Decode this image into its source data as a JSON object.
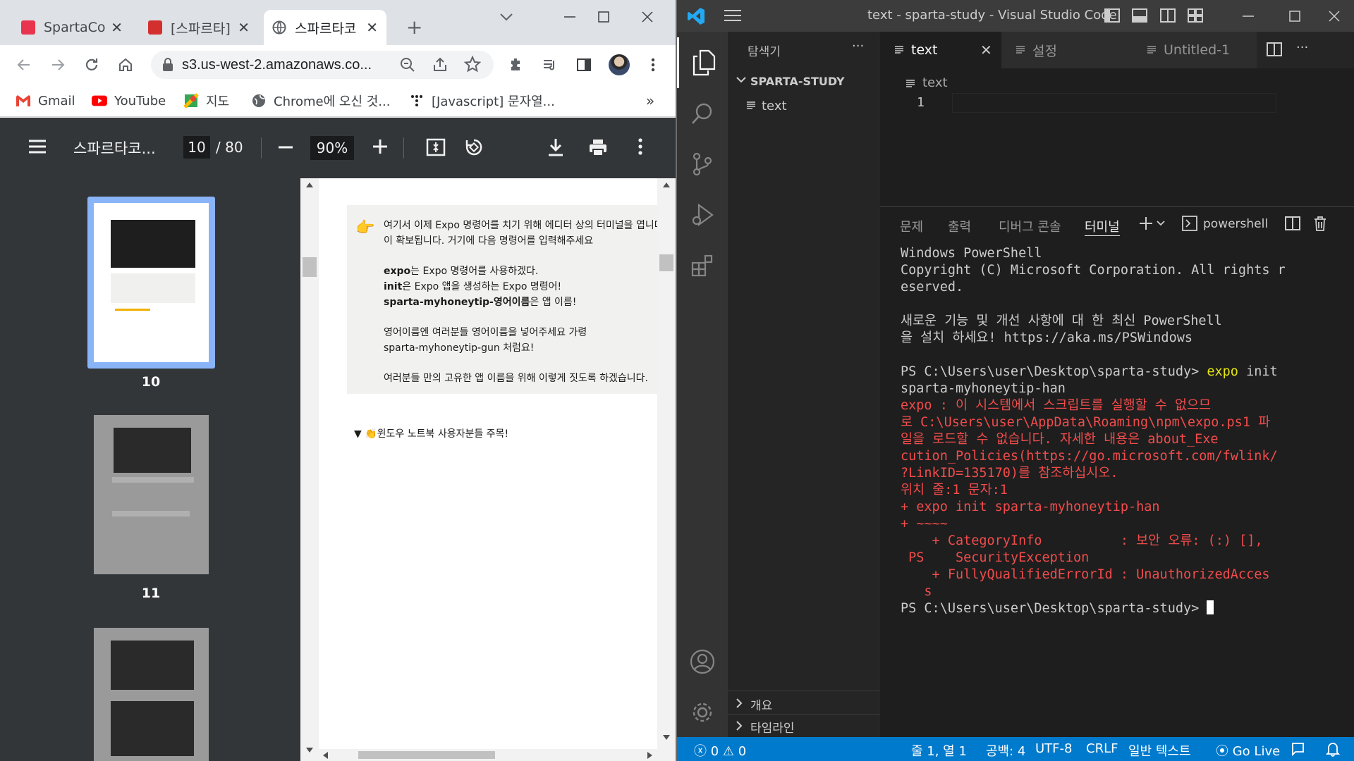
{
  "chrome": {
    "tabs": [
      {
        "title": "SpartaCod",
        "active": false
      },
      {
        "title": "[스파르타]",
        "active": false
      },
      {
        "title": "스파르타코",
        "active": true
      }
    ],
    "new_tab": "+",
    "url": "s3.us-west-2.amazonaws.co...",
    "bookmarks": [
      {
        "label": "Gmail"
      },
      {
        "label": "YouTube"
      },
      {
        "label": "지도"
      },
      {
        "label": "Chrome에 오신 것..."
      },
      {
        "label": "[Javascript] 문자열..."
      }
    ],
    "bookmarks_more": "»"
  },
  "pdf": {
    "title": "스파르타코...",
    "current_page": "10",
    "total_pages": "/ 80",
    "zoom": "90%",
    "thumbnails": [
      {
        "num": "10",
        "selected": true
      },
      {
        "num": "11",
        "selected": false
      }
    ],
    "callout_lines": [
      {
        "text": "여기서 이제 Expo 명령어를 치기 위해 에디터 상의 터미널을 엽니다."
      },
      {
        "text": "이 확보됩니다. 거기에 다음 명령어를 입력해주세요"
      },
      {
        "text": ""
      },
      {
        "bold": "expo",
        "rest": "는 Expo 명령어를 사용하겠다."
      },
      {
        "bold": "init",
        "rest": "은 Expo 앱을 생성하는 Expo 명령어!"
      },
      {
        "bold": "sparta-myhoneytip-영어이름",
        "rest": "은 앱 이름!"
      },
      {
        "text": ""
      },
      {
        "text": "영어이름엔 여러분들 영어이름을 넣어주세요 가령"
      },
      {
        "text": "sparta-myhoneytip-gun 처럼요!"
      },
      {
        "text": ""
      },
      {
        "text": "여러분들 만의 고유한 앱 이름을 위해 이렇게 짓도록 하겠습니다."
      }
    ],
    "toggle_text": "▼ 👏윈도우 노트북 사용자분들 주목!"
  },
  "vscode": {
    "title": "text - sparta-study - Visual Studio Code",
    "explorer_title": "탐색기",
    "explorer_more": "···",
    "folder": "SPARTA-STUDY",
    "files": [
      "text"
    ],
    "outline": "개요",
    "timeline": "타임라인",
    "tabs": [
      {
        "label": "text",
        "active": true
      },
      {
        "label": "설정",
        "active": false
      },
      {
        "label": "Untitled-1",
        "active": false
      }
    ],
    "breadcrumb": "text",
    "line_number": "1",
    "panel_tabs": [
      "문제",
      "출력",
      "디버그 콘솔",
      "터미널"
    ],
    "terminal_shell": "powershell",
    "terminal": [
      {
        "parts": [
          {
            "t": "Windows PowerShell",
            "c": ""
          }
        ]
      },
      {
        "parts": [
          {
            "t": "Copyright (C) Microsoft Corporation. All rights r",
            "c": ""
          }
        ]
      },
      {
        "parts": [
          {
            "t": "eserved.",
            "c": ""
          }
        ]
      },
      {
        "parts": [
          {
            "t": "",
            "c": ""
          }
        ]
      },
      {
        "parts": [
          {
            "t": "새로운 기능 및 개선 사항에 대 한 최신 PowerShell",
            "c": ""
          }
        ]
      },
      {
        "parts": [
          {
            "t": "을 설치 하세요! https://aka.ms/PSWindows",
            "c": ""
          }
        ]
      },
      {
        "parts": [
          {
            "t": "",
            "c": ""
          }
        ]
      },
      {
        "parts": [
          {
            "t": "PS C:\\Users\\user\\Desktop\\sparta-study> ",
            "c": ""
          },
          {
            "t": "expo",
            "c": "yel"
          },
          {
            "t": " init",
            "c": ""
          }
        ]
      },
      {
        "parts": [
          {
            "t": "sparta-myhoneytip-han",
            "c": ""
          }
        ]
      },
      {
        "parts": [
          {
            "t": "expo : 이 시스템에서 스크립트를 실행할 수 없으므",
            "c": "red"
          }
        ]
      },
      {
        "parts": [
          {
            "t": "로 C:\\Users\\user\\AppData\\Roaming\\npm\\expo.ps1 파",
            "c": "red"
          }
        ]
      },
      {
        "parts": [
          {
            "t": "일을 로드할 수 없습니다. 자세한 내용은 about_Exe",
            "c": "red"
          }
        ]
      },
      {
        "parts": [
          {
            "t": "cution_Policies(https://go.microsoft.com/fwlink/",
            "c": "red"
          }
        ]
      },
      {
        "parts": [
          {
            "t": "?LinkID=135170)를 참조하십시오.",
            "c": "red"
          }
        ]
      },
      {
        "parts": [
          {
            "t": "위치 줄:1 문자:1",
            "c": "red"
          }
        ]
      },
      {
        "parts": [
          {
            "t": "+ expo init sparta-myhoneytip-han",
            "c": "red"
          }
        ]
      },
      {
        "parts": [
          {
            "t": "+ ~~~~",
            "c": "red"
          }
        ]
      },
      {
        "parts": [
          {
            "t": "    + CategoryInfo          : 보안 오류: (:) [],",
            "c": "red"
          }
        ]
      },
      {
        "parts": [
          {
            "t": " PS",
            "c": "red"
          },
          {
            "t": "    SecurityException",
            "c": "red"
          }
        ]
      },
      {
        "parts": [
          {
            "t": "    + FullyQualifiedErrorId : UnauthorizedAcces",
            "c": "red"
          }
        ]
      },
      {
        "parts": [
          {
            "t": "   s",
            "c": "red"
          }
        ]
      },
      {
        "parts": [
          {
            "t": "PS C:\\Users\\user\\Desktop\\sparta-study> ",
            "c": ""
          }
        ]
      }
    ],
    "status": {
      "errors": "0",
      "warnings": "0",
      "position": "줄 1, 열 1",
      "spaces": "공백: 4",
      "encoding": "UTF-8",
      "eol": "CRLF",
      "language": "일반 텍스트",
      "live": "Go Live"
    }
  },
  "colors": {
    "vscode_accent": "#007acc",
    "terminal_error": "#f14c4c",
    "terminal_command": "#e5e510",
    "thumbnail_selected": "#8ab4f8"
  }
}
